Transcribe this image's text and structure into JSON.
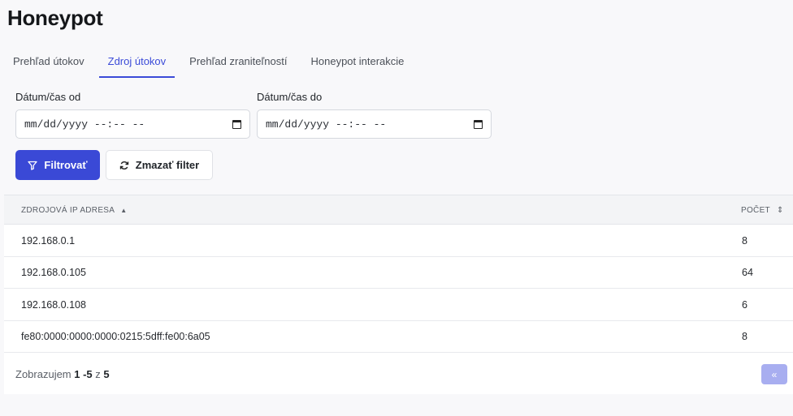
{
  "page": {
    "title": "Honeypot"
  },
  "tabs": [
    {
      "label": "Prehľad útokov",
      "active": false
    },
    {
      "label": "Zdroj útokov",
      "active": true
    },
    {
      "label": "Prehľad zraniteľností",
      "active": false
    },
    {
      "label": "Honeypot interakcie",
      "active": false
    }
  ],
  "filters": {
    "from_label": "Dátum/čas od",
    "to_label": "Dátum/čas do",
    "from_value": "mm/dd/yyyy --:-- --",
    "to_value": "mm/dd/yyyy --:-- --"
  },
  "buttons": {
    "filter_label": "Filtrovať",
    "clear_label": "Zmazať filter"
  },
  "table": {
    "headers": {
      "ip": "ZDROJOVÁ IP ADRESA",
      "count": "POČET"
    },
    "rows": [
      {
        "ip": "192.168.0.1",
        "count": "8"
      },
      {
        "ip": "192.168.0.105",
        "count": "64"
      },
      {
        "ip": "192.168.0.108",
        "count": "6"
      },
      {
        "ip": "fe80:0000:0000:0000:0215:5dff:fe00:6a05",
        "count": "8"
      }
    ]
  },
  "pagination": {
    "prefix": "Zobrazujem",
    "range": "1 -5",
    "sep": "z",
    "total": "5",
    "prev_label": "«"
  }
}
